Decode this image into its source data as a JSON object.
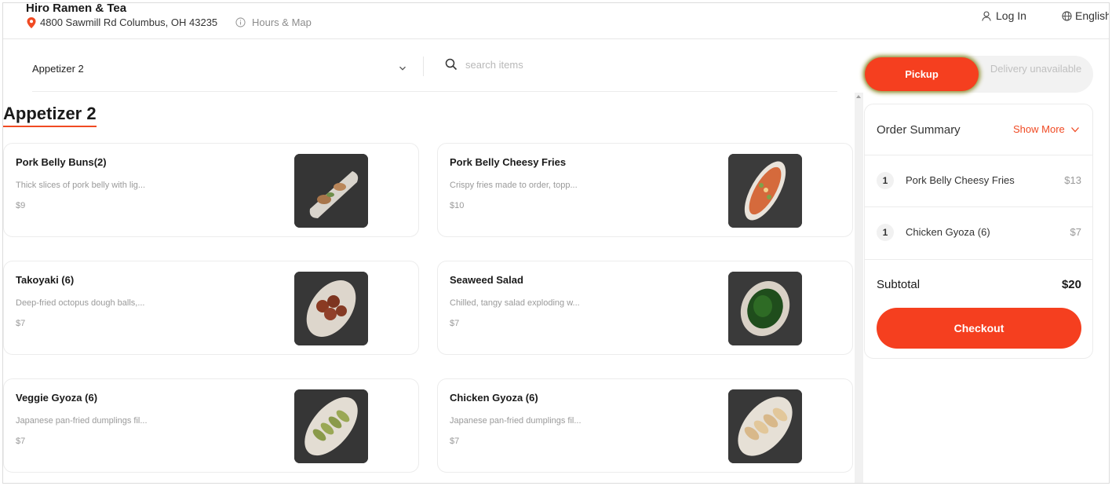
{
  "header": {
    "restaurant_name": "Hiro Ramen & Tea",
    "address": "4800 Sawmill Rd Columbus, OH 43235",
    "hours_link": "Hours & Map",
    "login": "Log In",
    "language": "English"
  },
  "toolbar": {
    "category_selected": "Appetizer 2",
    "search_placeholder": "search items"
  },
  "section": {
    "title": "Appetizer 2"
  },
  "items": [
    {
      "name": "Pork Belly Buns(2)",
      "desc": "Thick slices of pork belly with lig...",
      "price": "$9"
    },
    {
      "name": "Pork Belly Cheesy Fries",
      "desc": "Crispy fries made to order, topp...",
      "price": "$10"
    },
    {
      "name": "Takoyaki (6)",
      "desc": "Deep-fried octopus dough balls,...",
      "price": "$7"
    },
    {
      "name": "Seaweed Salad",
      "desc": "Chilled, tangy salad exploding w...",
      "price": "$7"
    },
    {
      "name": "Veggie Gyoza (6)",
      "desc": "Japanese pan-fried dumplings fil...",
      "price": "$7"
    },
    {
      "name": "Chicken Gyoza (6)",
      "desc": "Japanese pan-fried dumplings fil...",
      "price": "$7"
    }
  ],
  "order_type": {
    "pickup": "Pickup",
    "delivery": "Delivery unavailable",
    "selected": "pickup"
  },
  "summary": {
    "title": "Order Summary",
    "show_more": "Show More",
    "lines": [
      {
        "qty": "1",
        "name": "Pork Belly Cheesy Fries",
        "price": "$13"
      },
      {
        "qty": "1",
        "name": "Chicken Gyoza (6)",
        "price": "$7"
      }
    ],
    "subtotal_label": "Subtotal",
    "subtotal_value": "$20",
    "checkout": "Checkout"
  },
  "colors": {
    "accent": "#f53f1f",
    "muted_text": "#9a9a9a"
  }
}
